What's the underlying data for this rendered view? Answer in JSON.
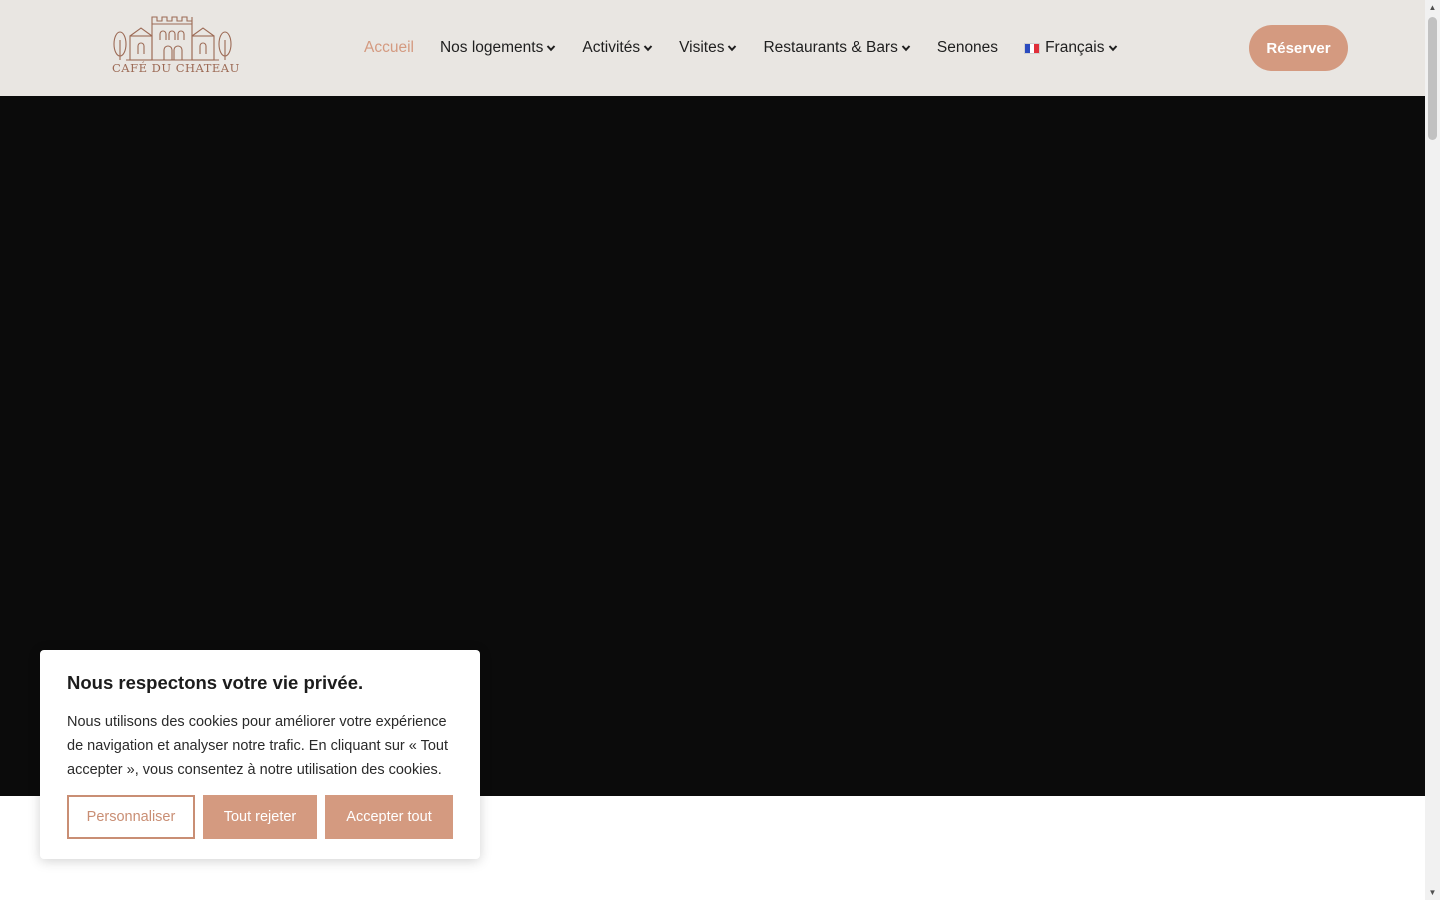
{
  "header": {
    "logo_text": "CAFÉ DU CHATEAU",
    "nav": [
      {
        "label": "Accueil",
        "active": true,
        "dropdown": false
      },
      {
        "label": "Nos logements",
        "dropdown": true
      },
      {
        "label": "Activités",
        "dropdown": true
      },
      {
        "label": "Visites",
        "dropdown": true
      },
      {
        "label": "Restaurants & Bars",
        "dropdown": true
      },
      {
        "label": "Senones",
        "dropdown": false
      },
      {
        "label": "Français",
        "dropdown": true,
        "icon": "france-flag-icon"
      }
    ],
    "reserve_label": "Réserver"
  },
  "cookie_banner": {
    "title": "Nous respectons votre vie privée.",
    "text": "Nous utilisons des cookies pour améliorer votre expérience de navigation et analyser notre trafic. En cliquant sur « Tout accepter », vous consentez à notre utilisation des cookies.",
    "customize_label": "Personnaliser",
    "reject_label": "Tout rejeter",
    "accept_label": "Accepter tout"
  },
  "colors": {
    "accent": "#d49a80",
    "header_bg": "#e9e6e2",
    "hero_bg": "#0b0b0b"
  }
}
